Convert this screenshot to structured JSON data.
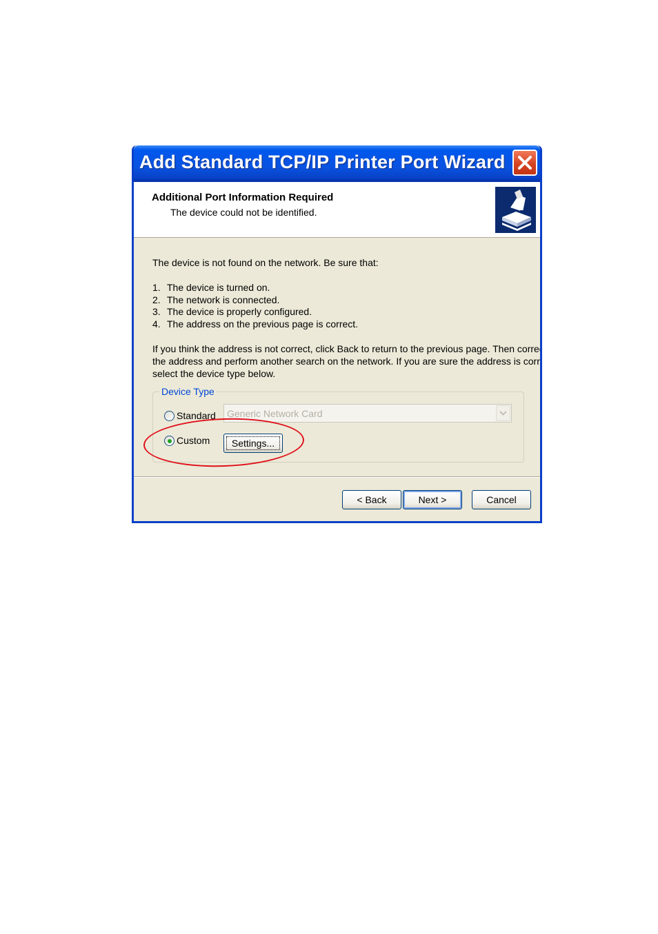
{
  "window": {
    "title": "Add Standard TCP/IP Printer Port Wizard",
    "close_icon": "close-icon"
  },
  "header": {
    "title": "Additional Port Information Required",
    "subtitle": "The device could not be identified.",
    "icon": "printer-port-icon"
  },
  "content": {
    "intro": "The device is not found on the network.  Be sure that:",
    "checklist": [
      {
        "num": "1.",
        "text": "The device is turned on."
      },
      {
        "num": "2.",
        "text": "The network is connected."
      },
      {
        "num": "3.",
        "text": "The device is properly configured."
      },
      {
        "num": "4.",
        "text": "The address on the previous page is correct."
      }
    ],
    "paragraph_lines": [
      "If you think the address is not correct, click Back to return to the previous page.  Then correct",
      "the address and perform another search on the network.  If you are sure the address is correct,",
      "select the device type below."
    ]
  },
  "device_type": {
    "group_label": "Device Type",
    "standard_label": "Standard",
    "standard_selected": false,
    "standard_value": "Generic Network Card",
    "custom_label": "Custom",
    "custom_selected": true,
    "settings_button": "Settings..."
  },
  "footer": {
    "back_button": "< Back",
    "next_button": "Next >",
    "cancel_button": "Cancel"
  },
  "colors": {
    "titlebar": "#0a52e0",
    "group_label": "#0046d5",
    "annotation": "#e0101a"
  }
}
